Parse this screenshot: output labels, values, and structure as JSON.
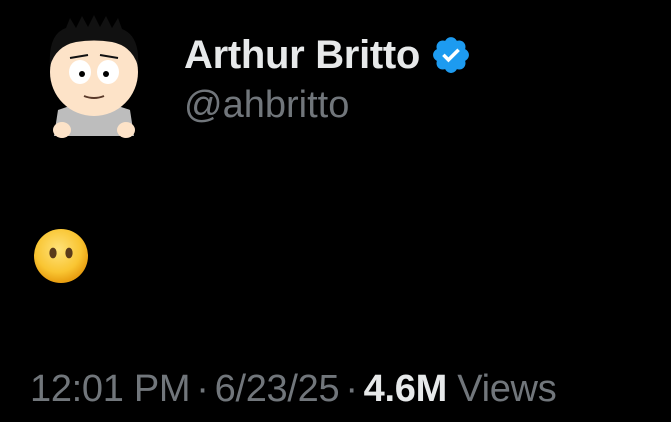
{
  "author": {
    "display_name": "Arthur Britto",
    "handle": "@ahbritto",
    "verified": true,
    "verified_color": "#1d9bf0",
    "avatar_icon": "cartoon-avatar"
  },
  "tweet": {
    "content_emoji": "face-without-mouth-emoji",
    "time": "12:01 PM",
    "date": "6/23/25",
    "separator": "·",
    "views_count": "4.6M",
    "views_label": "Views"
  },
  "colors": {
    "background": "#000000",
    "primary_text": "#e7e9ea",
    "secondary_text": "#71767b"
  }
}
